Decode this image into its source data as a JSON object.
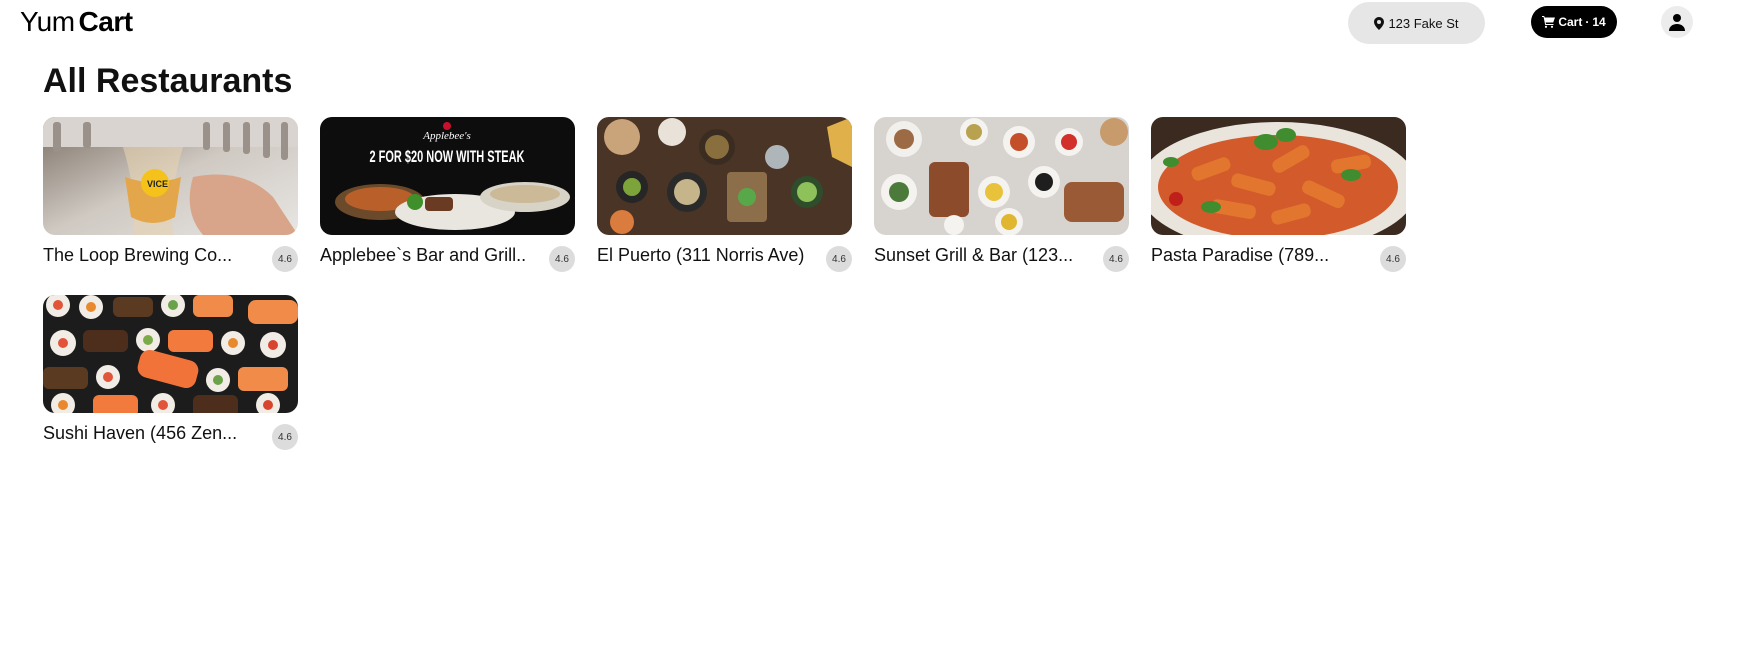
{
  "header": {
    "logo_light": "Yum",
    "logo_bold": "Cart",
    "address": "123 Fake St",
    "cart_label": "Cart",
    "cart_separator": "·",
    "cart_count": "14"
  },
  "main": {
    "title": "All Restaurants",
    "restaurants": [
      {
        "name": "The Loop Brewing Co...",
        "rating": "4.6",
        "image": "beer-tap-photo"
      },
      {
        "name": "Applebee`s Bar and Grill...",
        "rating": "4.6",
        "image": "applebees-steak-promo",
        "promo_brand": "Applebee's",
        "promo_text": "2 FOR $20 NOW WITH STEAK"
      },
      {
        "name": "El Puerto (311 Norris Ave)",
        "rating": "4.6",
        "image": "mexican-spread-photo"
      },
      {
        "name": "Sunset Grill & Bar (123...",
        "rating": "4.6",
        "image": "grill-plates-photo"
      },
      {
        "name": "Pasta Paradise (789...",
        "rating": "4.6",
        "image": "penne-pasta-photo"
      },
      {
        "name": "Sushi Haven (456 Zen...",
        "rating": "4.6",
        "image": "sushi-platter-photo"
      }
    ]
  },
  "colors": {
    "background": "#ffffff",
    "address_pill": "#e6e6e6",
    "cart_pill": "#000000",
    "rating_badge": "#dcdcdc"
  }
}
